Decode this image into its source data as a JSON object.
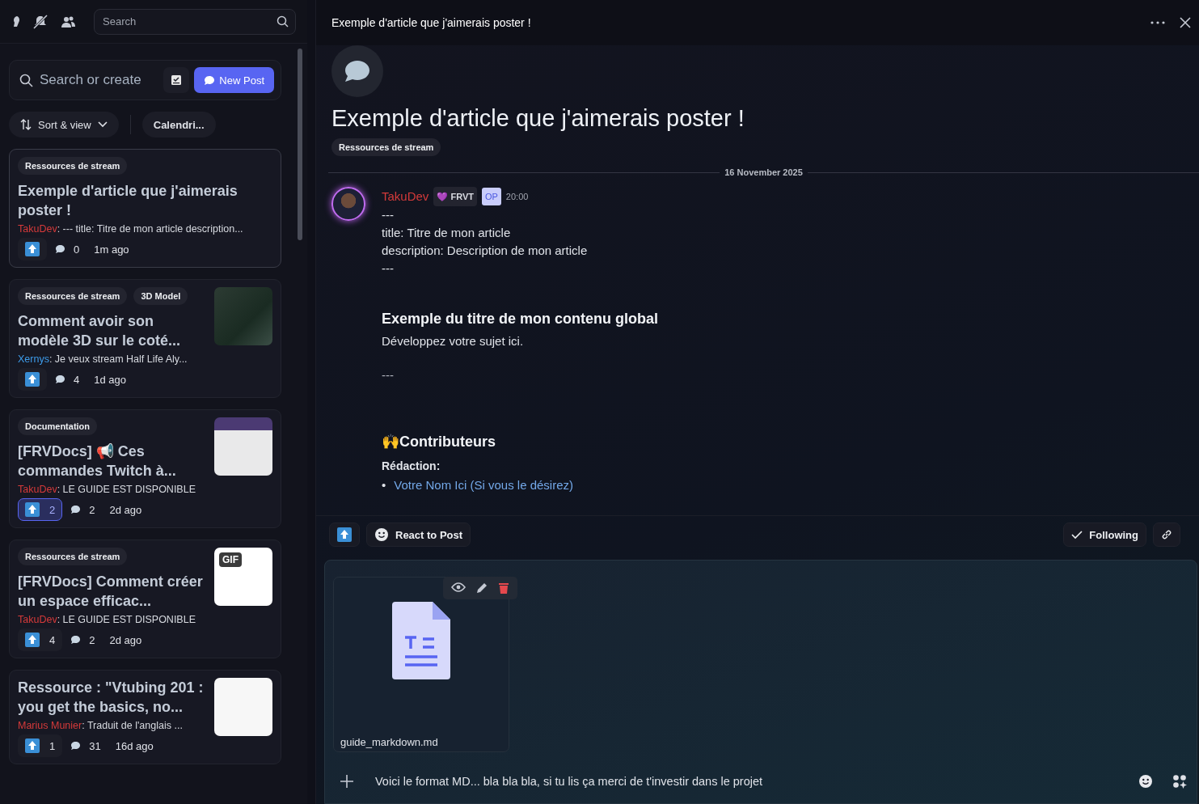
{
  "top_bar": {
    "search": {
      "placeholder": "Search"
    }
  },
  "forum": {
    "search": {
      "placeholder": "Search or create"
    },
    "new_post": "New Post",
    "sort": "Sort & view",
    "calendar_tag": "Calendri...",
    "posts": [
      {
        "tags": [
          "Ressources de stream"
        ],
        "title": "Exemple d'article que j'aimerais poster !",
        "author": "TakuDev",
        "color": "#d63a3a",
        "preview": ": --- title: Titre de mon article description...",
        "upvoted": false,
        "comments": "0",
        "time": "1m ago",
        "selected": true
      },
      {
        "tags": [
          "Ressources de stream",
          "3D Model"
        ],
        "title": "Comment avoir son modèle 3D sur le coté...",
        "author": "Xernys",
        "color": "#3d9be9",
        "preview": ": Je veux stream Half Life Aly...",
        "upvoted": false,
        "comments": "4",
        "time": "1d ago",
        "thumbnail": {
          "kind": "photo"
        },
        "selected": false
      },
      {
        "tags": [
          "Documentation"
        ],
        "title": "[FRVDocs] 📢 Ces commandes Twitch à...",
        "author": "TakuDev",
        "color": "#d63a3a",
        "preview": ": LE GUIDE EST DISPONIBLE",
        "upvoted": true,
        "votes": "2",
        "comments": "2",
        "time": "2d ago",
        "thumbnail": {
          "kind": "screenshot"
        },
        "selected": false
      },
      {
        "tags": [
          "Ressources de stream"
        ],
        "title": "[FRVDocs] Comment créer un espace efficac...",
        "author": "TakuDev",
        "color": "#d63a3a",
        "preview": ": LE GUIDE EST DISPONIBLE",
        "upvoted": false,
        "votes": "4",
        "comments": "2",
        "time": "2d ago",
        "thumbnail": {
          "kind": "gif",
          "label": "GIF"
        },
        "selected": false
      },
      {
        "title": "Ressource : \"Vtubing 201 : you get the basics, no...",
        "author": "Marius Munier",
        "color": "#d63a3a",
        "preview": ": Traduit de l'anglais ...",
        "upvoted": false,
        "votes": "1",
        "comments": "31",
        "time": "16d ago",
        "thumbnail": {
          "kind": "document"
        },
        "selected": false
      }
    ]
  },
  "thread": {
    "header_title": "Exemple d'article que j'aimerais poster !",
    "title": "Exemple d'article que j'aimerais poster !",
    "tag": "Ressources de stream",
    "date": "16 November 2025",
    "message": {
      "author": "TakuDev",
      "badge": "💜 FRVT",
      "op": "OP",
      "time": "20:00",
      "blocks": [
        {
          "kind": "line",
          "text": "---"
        },
        {
          "kind": "line",
          "text": "title: Titre de mon article"
        },
        {
          "kind": "line",
          "text": "description: Description de mon article"
        },
        {
          "kind": "line",
          "text": "---"
        },
        {
          "kind": "heading",
          "text": "Exemple du titre de mon contenu global"
        },
        {
          "kind": "paragraph",
          "text": "Développez votre sujet ici."
        },
        {
          "kind": "rule",
          "text": "---"
        },
        {
          "kind": "heading",
          "text": "🙌Contributeurs"
        },
        {
          "kind": "label",
          "text": "Rédaction:"
        },
        {
          "kind": "bullet",
          "marker": "•",
          "text": "Votre Nom Ici (Si vous le désirez)"
        }
      ]
    },
    "actions": {
      "react": "React to Post",
      "following": "Following"
    },
    "composer": {
      "attachment": "guide_markdown.md",
      "value": "Voici le format MD... bla bla bla, si tu lis ça merci de t'investir dans le projet"
    }
  }
}
